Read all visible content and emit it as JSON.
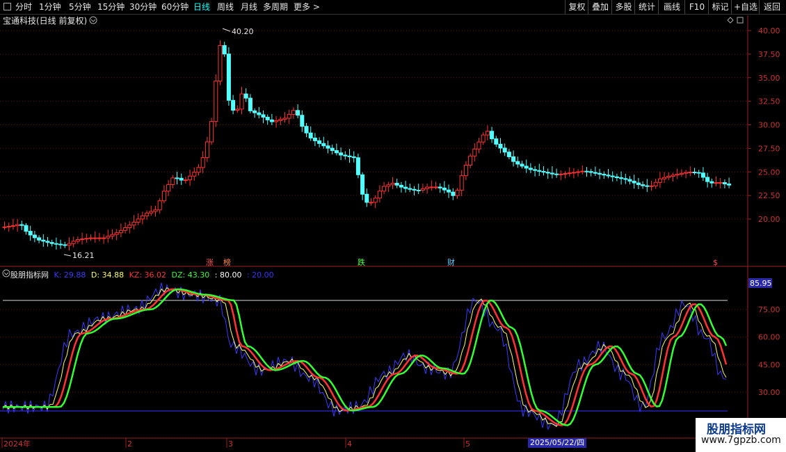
{
  "topbar": {
    "periods": [
      "分时",
      "1分钟",
      "5分钟",
      "15分钟",
      "30分钟",
      "60分钟",
      "日线",
      "周线",
      "月线",
      "多周期",
      "更多"
    ],
    "active_period": "日线",
    "more_arrow": ">",
    "right_buttons": [
      "复权",
      "叠加",
      "多股",
      "统计",
      "画线",
      "F10",
      "标记",
      "+自选",
      "返回"
    ]
  },
  "chart_header": {
    "stock_title": "宝通科技(日线 前复权)",
    "dropdown_icon": "chevron-down-icon"
  },
  "indicator_header": {
    "name": "股朋指标网",
    "k": "K: 29.88",
    "d": "D: 34.88",
    "kz": "KZ: 36.02",
    "dz": "DZ: 43.30",
    "line80": ": 80.00",
    "line20": ": 20.00",
    "colors": {
      "k": "#3a3aff",
      "d": "#ffff66",
      "kz": "#ff3333",
      "dz": "#33ff33",
      "line80": "#ffffff",
      "line20": "#3333ff"
    }
  },
  "price_axis": {
    "ticks": [
      "40.00",
      "37.50",
      "35.00",
      "32.50",
      "30.00",
      "27.50",
      "25.00",
      "22.50",
      "20.00"
    ],
    "high_label": "40.20",
    "low_label": "16.21"
  },
  "indicator_axis": {
    "ticks": [
      "75.00",
      "60.00",
      "45.00",
      "30.00"
    ],
    "current_badge": "85.95"
  },
  "markers": {
    "zhang": "涨",
    "bang": "榜",
    "die": "跌",
    "cai": "财",
    "dollar": "$"
  },
  "date_axis": {
    "labels": [
      "2024年",
      "2",
      "3",
      "4",
      "5"
    ],
    "tooltip": "2025/05/22/四"
  },
  "watermark": {
    "line1": "股朋指标网",
    "line2": "www.7gpzb.com"
  },
  "colors": {
    "up": "#ff3232",
    "down": "#54ffff",
    "grid": "#7a1a1a",
    "axis": "#9a1f1f"
  }
}
